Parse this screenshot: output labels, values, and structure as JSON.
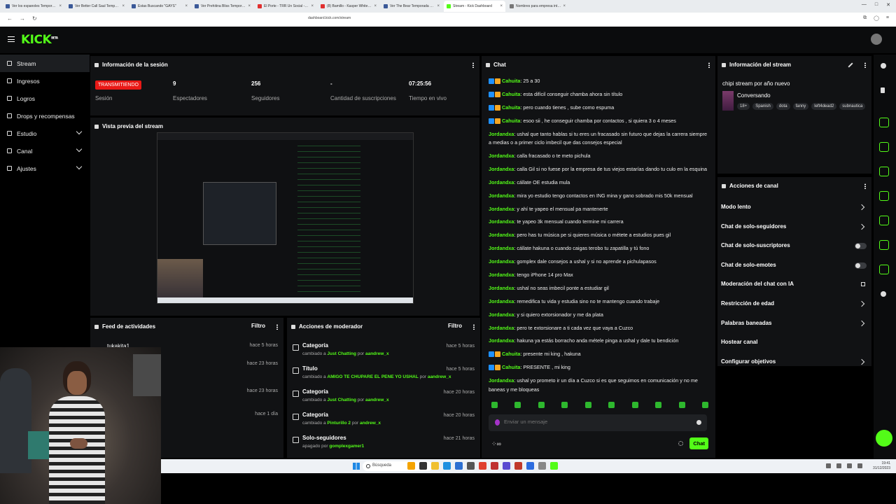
{
  "browser": {
    "tabs": [
      {
        "label": "Ver los espanoles Temporada 9 Epi...",
        "color": "#3b5998",
        "active": false
      },
      {
        "label": "Ver Better Call Saul Temporada 2 Ep...",
        "color": "#3b5998",
        "active": false
      },
      {
        "label": "Estas Buscando \"GAYS\"",
        "color": "#3b5998",
        "active": false
      },
      {
        "label": "Ver Prehitina Bliss Temporada 2 Episo...",
        "color": "#3b5998",
        "active": false
      },
      {
        "label": "El Porte - TRR Un Social - YouTube",
        "color": "#e02f2f",
        "active": false
      },
      {
        "label": "(8) Bamillo - Kasper White ft. Si...",
        "color": "#e02f2f",
        "active": false
      },
      {
        "label": "Ver The Bear Temporada 2 Episodio...",
        "color": "#3b5998",
        "active": false
      },
      {
        "label": "Stream - Kick Dashboard",
        "color": "#53fc18",
        "active": true
      },
      {
        "label": "Nombres para empresa interna...",
        "color": "#777777",
        "active": false
      }
    ],
    "url": "dashboard.kick.com/stream"
  },
  "brand": {
    "logo": "KICK",
    "beta": "BETA",
    "accent": "#53fc18"
  },
  "sidebar": {
    "items": [
      {
        "label": "Stream",
        "icon": "broadcast-icon",
        "active": true,
        "chevron": false
      },
      {
        "label": "Ingresos",
        "icon": "income-icon",
        "active": false,
        "chevron": false
      },
      {
        "label": "Logros",
        "icon": "trophy-icon",
        "active": false,
        "chevron": false
      },
      {
        "label": "Drops y recompensas",
        "icon": "gift-icon",
        "active": false,
        "chevron": false
      },
      {
        "label": "Estudio",
        "icon": "studio-icon",
        "active": false,
        "chevron": true
      },
      {
        "label": "Canal",
        "icon": "channel-icon",
        "active": false,
        "chevron": true
      },
      {
        "label": "Ajustes",
        "icon": "settings-icon",
        "active": false,
        "chevron": true
      }
    ]
  },
  "session": {
    "title": "Información de la sesión",
    "status": "TRANSMITIENDO",
    "status_label": "Sesión",
    "stats": [
      {
        "value": "9",
        "label": "Espectadores"
      },
      {
        "value": "256",
        "label": "Seguidores"
      },
      {
        "value": "-",
        "label": "Cantidad de suscripciones"
      },
      {
        "value": "07:25:56",
        "label": "Tiempo en vivo"
      }
    ]
  },
  "preview": {
    "title": "Vista previa del stream"
  },
  "activity": {
    "title": "Feed de actividades",
    "filter": "Filtro",
    "rows": [
      {
        "name": "tukakita1",
        "time": "hace 5 horas"
      },
      {
        "name": "",
        "time": "hace 23 horas"
      },
      {
        "name": "",
        "time": "hace 23 horas"
      },
      {
        "name": "",
        "time": "hace 1 día"
      }
    ]
  },
  "mod": {
    "title": "Acciones de moderador",
    "filter": "Filtro",
    "rows": [
      {
        "title": "Categoría",
        "pre": "cambiado a ",
        "target": "Just Chatting",
        "mid": " por ",
        "user": "aandrew_x",
        "time": "hace 5 horas"
      },
      {
        "title": "Título",
        "pre": "cambiado a ",
        "target": "AMIGO TE CHUPARE EL PENE YO USHAL",
        "mid": " por ",
        "user": "aandrew_x",
        "time": "hace 5 horas"
      },
      {
        "title": "Categoría",
        "pre": "cambiado a ",
        "target": "Just Chatting",
        "mid": " por ",
        "user": "aandrew_x",
        "time": "hace 20 horas"
      },
      {
        "title": "Categoría",
        "pre": "cambiado a ",
        "target": "Pinturillo 2",
        "mid": " por ",
        "user": "andrew_x",
        "time": "hace 20 horas"
      },
      {
        "title": "Solo-seguidores",
        "pre": "apagado por ",
        "target": "",
        "mid": "",
        "user": "gomplexgamer1",
        "time": "hace 21 horas"
      }
    ]
  },
  "chat": {
    "title": "Chat",
    "messages": [
      {
        "user": "Cahuita",
        "text": "25 a 30",
        "badges": true
      },
      {
        "user": "Cahuita",
        "text": "esta difícil conseguir chamba ahora sin título",
        "badges": true
      },
      {
        "user": "Cahuita",
        "text": "pero cuando tienes , sube como espuma",
        "badges": true
      },
      {
        "user": "Cahuita",
        "text": "esoo sii , he conseguir chamba por contactos , si quiera 3 o 4 meses",
        "badges": true
      },
      {
        "user": "Jordandxa",
        "text": "ushal que tanto hablas si tu eres un fracasado sin futuro que dejas la carrera siempre a medias o a primer ciclo imbecil que das consejos especial",
        "badges": false
      },
      {
        "user": "Jordandxa",
        "text": "calla fracasado o te meto pichula",
        "badges": false
      },
      {
        "user": "Jordandxa",
        "text": "calla Gil si no fuese por la empresa de tus viejos estarías dando tu culo en la esquina",
        "badges": false
      },
      {
        "user": "Jordandxa",
        "text": "cállate OE estudia mula",
        "badges": false
      },
      {
        "user": "Jordandxa",
        "text": "mira yo estudio tengo contactos en ING mina y gano sobrado mis 50k mensual",
        "badges": false
      },
      {
        "user": "Jordandxa",
        "text": "y ahí te yapeo el mensual pa mantenerte",
        "badges": false
      },
      {
        "user": "Jordandxa",
        "text": "te yapeo 3k mensual cuando termine mi carrera",
        "badges": false
      },
      {
        "user": "Jordandxa",
        "text": "pero has tu música pe si quieres música o métete a estudios pues gil",
        "badges": false
      },
      {
        "user": "Jordandxa",
        "text": "cállate hakuna o cuando caigas terobo tu zapatilla y tú fono",
        "badges": false
      },
      {
        "user": "Jordandxa",
        "text": "gomplex dale consejos a ushal y si no aprende a pichulapasos",
        "badges": false
      },
      {
        "user": "Jordandxa",
        "text": "tengo iPhone 14 pro Max",
        "badges": false
      },
      {
        "user": "Jordandxa",
        "text": "ushal no seas imbecil ponte a estudiar gil",
        "badges": false
      },
      {
        "user": "Jordandxa",
        "text": "remedifica tu vida y estudia sino no te mantengo cuando trabaje",
        "badges": false
      },
      {
        "user": "Jordandxa",
        "text": "y si quiero extorsionador y me da plata",
        "badges": false
      },
      {
        "user": "Jordandxa",
        "text": "pero te extorsionare a ti cada vez que vaya a Cuzco",
        "badges": false
      },
      {
        "user": "Jordandxa",
        "text": "hakuna ya estás borracho anda métele pinga a ushal y dale tu bendición",
        "badges": false
      },
      {
        "user": "Cahuita",
        "text": "presente mi king , hakuna",
        "badges": true
      },
      {
        "user": "Cahuita",
        "text": "PRESENTE , mi king",
        "badges": true
      },
      {
        "user": "Jordandxa",
        "text": "ushal yo prometo ir un día a Cuzco si es que seguimos en comunicación y no me baneas y me bloqueas",
        "badges": false
      }
    ],
    "input_placeholder": "Enviar un mensaje",
    "bottom_left": "⁘∞",
    "send_label": "Chat"
  },
  "stream_info": {
    "title": "Información del stream",
    "stream_title": "chipi stream por año nuevo",
    "category": "Conversando",
    "tags": [
      "18+",
      "Spanish",
      "dota",
      "fanny",
      "left4dead2",
      "subnautica"
    ]
  },
  "channel_actions": {
    "title": "Acciones de canal",
    "items": [
      {
        "label": "Modo lento",
        "control": "chevron"
      },
      {
        "label": "Chat de solo-seguidores",
        "control": "chevron"
      },
      {
        "label": "Chat de solo-suscriptores",
        "control": "toggle"
      },
      {
        "label": "Chat de solo-emotes",
        "control": "toggle"
      },
      {
        "label": "Moderación del chat con IA",
        "control": "external"
      },
      {
        "label": "Restricción de edad",
        "control": "chevron"
      },
      {
        "label": "Palabras baneadas",
        "control": "chevron"
      },
      {
        "label": "Hostear canal",
        "control": "none"
      },
      {
        "label": "Configurar objetivos",
        "control": "chevron"
      }
    ]
  },
  "taskbar": {
    "search": "Búsqueda",
    "time": "19:41",
    "date": "31/12/2023"
  }
}
